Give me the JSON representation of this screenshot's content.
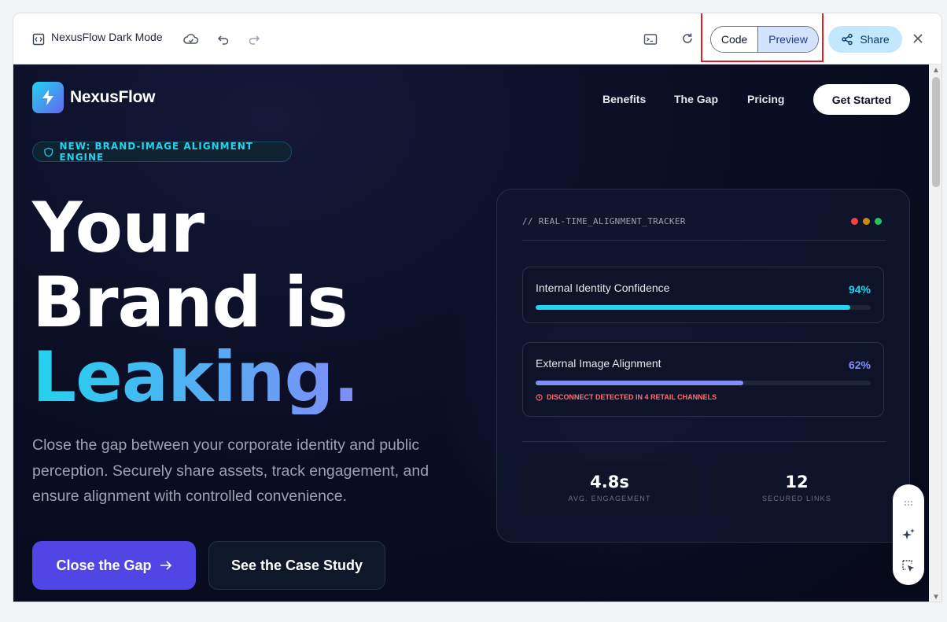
{
  "titlebar": {
    "title": "NexusFlow Dark Mode",
    "code_label": "Code",
    "preview_label": "Preview",
    "share_label": "Share"
  },
  "site": {
    "brand": "NexusFlow",
    "nav": [
      "Benefits",
      "The Gap",
      "Pricing"
    ],
    "cta": "Get Started",
    "badge": "NEW: BRAND-IMAGE ALIGNMENT ENGINE",
    "headline": {
      "line1": "Your",
      "line2": "Brand is",
      "line3": "Leaking."
    },
    "paragraph": "Close the gap between your corporate identity and public perception. Securely share assets, track engagement, and ensure alignment with controlled convenience.",
    "primary_button": "Close the Gap",
    "secondary_button": "See the Case Study"
  },
  "tracker": {
    "title": "// REAL-TIME_ALIGNMENT_TRACKER",
    "dot_colors": [
      "#ef4444",
      "#ca8a04",
      "#22c55e"
    ],
    "metrics": [
      {
        "label": "Internal Identity Confidence",
        "value": "94%",
        "fraction": 0.94,
        "color": "#22d3ee"
      },
      {
        "label": "External Image Alignment",
        "value": "62%",
        "fraction": 0.62,
        "color": "#818cf8",
        "warning": "DISCONNECT DETECTED IN 4 RETAIL CHANNELS"
      }
    ],
    "stats": [
      {
        "value": "4.8s",
        "label": "AVG. ENGAGEMENT"
      },
      {
        "value": "12",
        "label": "SECURED LINKS"
      }
    ]
  },
  "colors": {
    "accent_cyan": "#22d3ee",
    "accent_indigo": "#4f46e5",
    "background": "#0b0e24"
  }
}
